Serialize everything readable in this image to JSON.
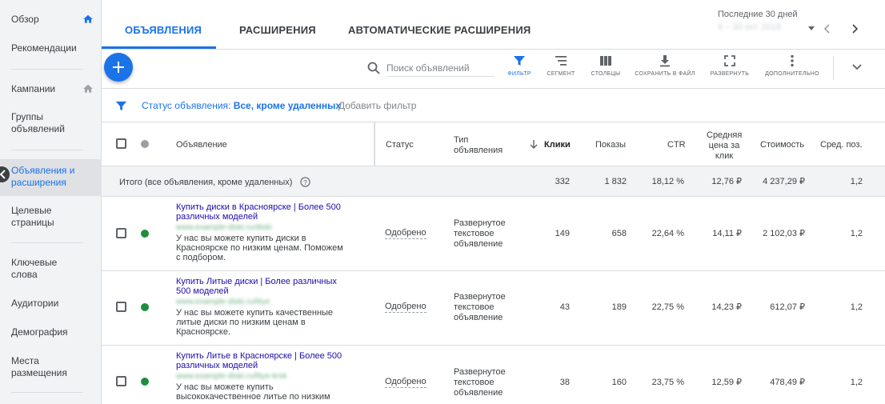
{
  "sidebar": {
    "items": [
      {
        "label": "Обзор"
      },
      {
        "label": "Рекомендации"
      },
      {
        "label": "Кампании"
      },
      {
        "label": "Группы объявлений"
      },
      {
        "label": "Объявления и расширения"
      },
      {
        "label": "Целевые страницы"
      },
      {
        "label": "Ключевые слова"
      },
      {
        "label": "Аудитории"
      },
      {
        "label": "Демография"
      },
      {
        "label": "Места размещения"
      }
    ]
  },
  "tabs": [
    {
      "label": "ОБЪЯВЛЕНИЯ"
    },
    {
      "label": "РАСШИРЕНИЯ"
    },
    {
      "label": "АВТОМАТИЧЕСКИЕ РАСШИРЕНИЯ"
    }
  ],
  "date": {
    "label": "Последние 30 дней",
    "range": "9 – 30 окт. 2018"
  },
  "toolbar": {
    "search_placeholder": "Поиск объявлений",
    "filter": "ФИЛЬТР",
    "segment": "СЕГМЕНТ",
    "columns": "СТОЛБЦЫ",
    "save": "СОХРАНИТЬ В ФАЙЛ",
    "expand": "РАЗВЕРНУТЬ",
    "more": "ДОПОЛНИТЕЛЬНО"
  },
  "filterbar": {
    "prefix": "Статус объявления:",
    "value": "Все, кроме удаленных",
    "add": "Добавить фильтр"
  },
  "table": {
    "headers": {
      "ad": "Объявление",
      "status": "Статус",
      "type_1": "Тип",
      "type_2": "объявления",
      "clicks": "Клики",
      "impressions": "Показы",
      "ctr": "CTR",
      "cpc_1": "Средняя",
      "cpc_2": "цена за",
      "cpc_3": "клик",
      "cost": "Стоимость",
      "pos": "Сред. поз."
    },
    "total": {
      "label": "Итого (все объявления, кроме удаленных)",
      "clicks": "332",
      "impressions": "1 832",
      "ctr": "18,12 %",
      "cpc": "12,76 ₽",
      "cost": "4 237,29 ₽",
      "pos": "1,2"
    },
    "rows": [
      {
        "title": "Купить диски в Красноярске | Более 500 различных моделей",
        "url": "www.example-diski.ru/diski",
        "desc": "У нас вы можете купить диски в Красноярске по низким ценам. Поможем с подбором.",
        "status": "Одобрено",
        "type": "Развернутое текстовое объявление",
        "clicks": "149",
        "impressions": "658",
        "ctr": "22,64 %",
        "cpc": "14,11 ₽",
        "cost": "2 102,03 ₽",
        "pos": "1,2"
      },
      {
        "title": "Купить Литые диски | Более различных 500 моделей",
        "url": "www.example-diski.ru/litye",
        "desc": "У нас вы можете купить качественные литые диски по низким ценам в Красноярске.",
        "status": "Одобрено",
        "type": "Развернутое текстовое объявление",
        "clicks": "43",
        "impressions": "189",
        "ctr": "22,75 %",
        "cpc": "14,23 ₽",
        "cost": "612,07 ₽",
        "pos": "1,2"
      },
      {
        "title": "Купить Литье в Красноярске | Более 500 различных моделей",
        "url": "www.example-diski.ru/litye-krsk",
        "desc": "У нас вы можете купить высококачественное литье по низким",
        "status": "Одобрено",
        "type": "Развернутое текстовое объявление",
        "clicks": "38",
        "impressions": "160",
        "ctr": "23,75 %",
        "cpc": "12,59 ₽",
        "cost": "478,49 ₽",
        "pos": "1,2"
      }
    ]
  },
  "colors": {
    "accent": "#1a73e8",
    "status_ok": "#1e8e3e",
    "status_neutral": "#9aa0a6"
  }
}
